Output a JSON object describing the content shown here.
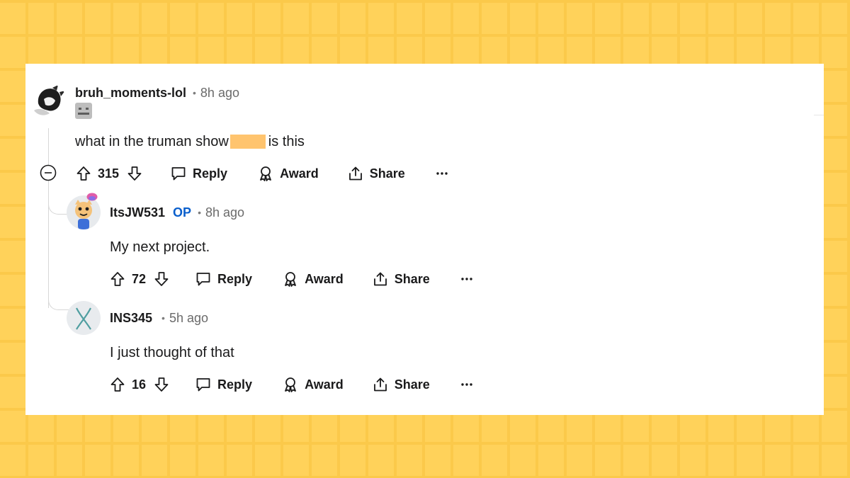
{
  "comments": [
    {
      "username": "bruh_moments-lol",
      "op": "",
      "separator": "•",
      "time": "8h ago",
      "text_before": "what in the truman show",
      "text_after": "is this",
      "votes": "315",
      "reply": "Reply",
      "award": "Award",
      "share": "Share",
      "more": "···"
    },
    {
      "username": "ItsJW531",
      "op": "OP",
      "separator": "•",
      "time": "8h ago",
      "text": "My next project.",
      "votes": "72",
      "reply": "Reply",
      "award": "Award",
      "share": "Share",
      "more": "···"
    },
    {
      "username": "INS345",
      "op": "",
      "separator": "•",
      "time": "5h ago",
      "text": "I just thought of that",
      "votes": "16",
      "reply": "Reply",
      "award": "Award",
      "share": "Share",
      "more": "···"
    }
  ],
  "colors": {
    "background": "#ffd25a",
    "card": "#ffffff",
    "op_badge": "#0a5fcc",
    "redaction": "#ffc46e"
  }
}
